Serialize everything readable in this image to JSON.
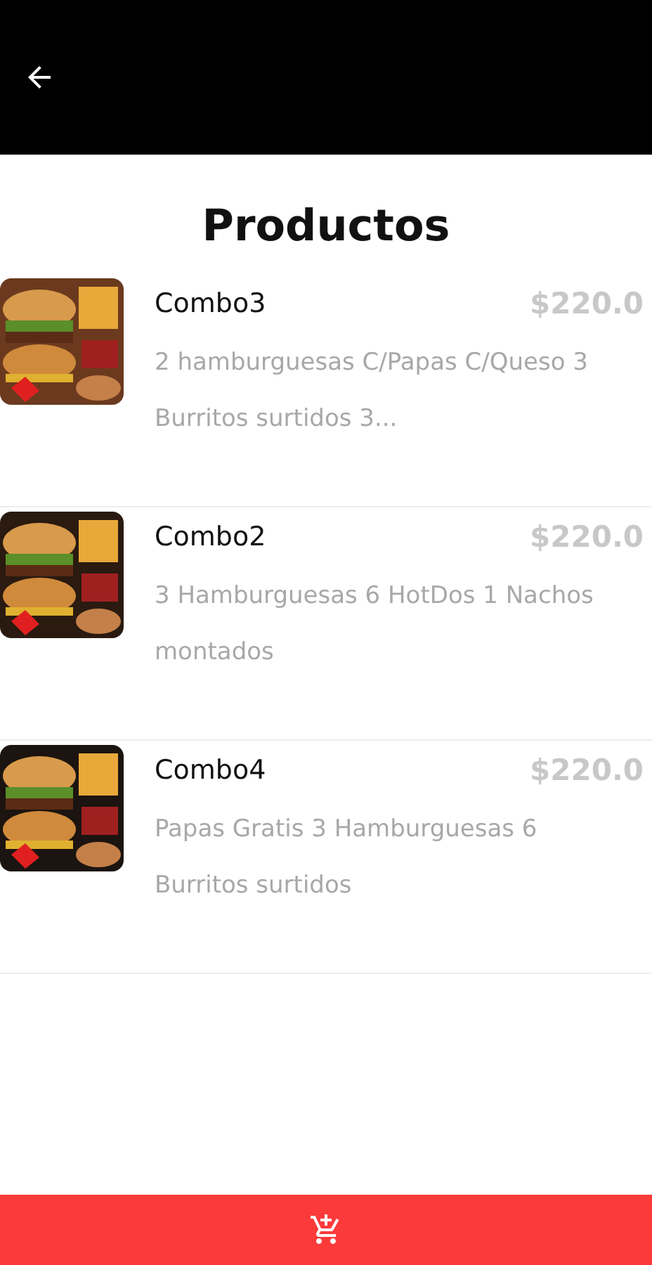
{
  "title": "Productos",
  "products": [
    {
      "name": "Combo3",
      "price": "$220.0",
      "description": "2 hamburguesas C/Papas C/Queso 3 Burritos surtidos 3..."
    },
    {
      "name": "Combo2",
      "price": "$220.0",
      "description": "3 Hamburguesas 6 HotDos 1 Nachos montados"
    },
    {
      "name": "Combo4",
      "price": "$220.0",
      "description": "Papas Gratis 3 Hamburguesas 6 Burritos surtidos"
    }
  ]
}
